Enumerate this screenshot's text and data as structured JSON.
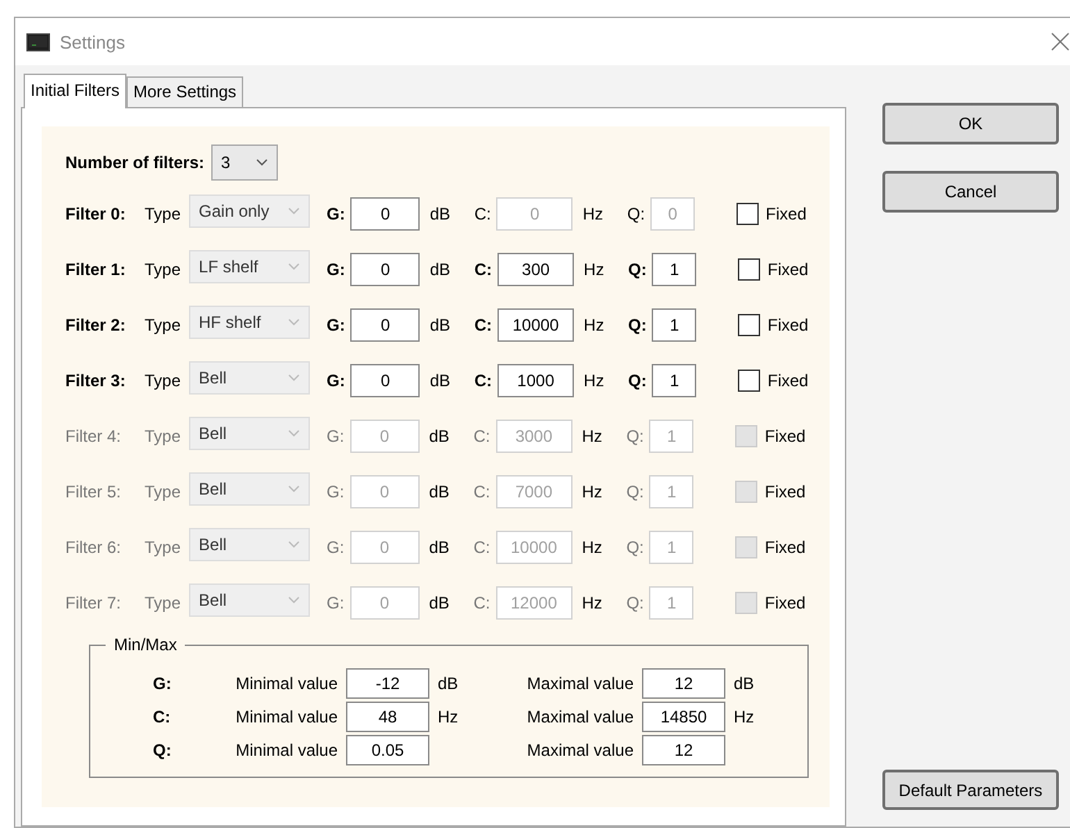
{
  "window": {
    "title": "Settings"
  },
  "tabs": [
    {
      "label": "Initial Filters",
      "selected": true
    },
    {
      "label": "More Settings",
      "selected": false
    }
  ],
  "number_of_filters": {
    "label": "Number of filters:",
    "value": "3"
  },
  "filters": [
    {
      "label": "Filter 0:",
      "enabled": true,
      "type_label": "Type",
      "type": "Gain only",
      "gain": {
        "label": "G:",
        "value": "0",
        "unit": "dB",
        "disabled": false
      },
      "center": {
        "label": "C:",
        "value": "0",
        "unit": "Hz",
        "disabled": true
      },
      "q": {
        "label": "Q:",
        "value": "0",
        "disabled": true
      },
      "fixed": {
        "label": "Fixed",
        "checked": false
      }
    },
    {
      "label": "Filter 1:",
      "enabled": true,
      "type_label": "Type",
      "type": "LF shelf",
      "gain": {
        "label": "G:",
        "value": "0",
        "unit": "dB",
        "disabled": false
      },
      "center": {
        "label": "C:",
        "value": "300",
        "unit": "Hz",
        "disabled": false
      },
      "q": {
        "label": "Q:",
        "value": "1",
        "disabled": false
      },
      "fixed": {
        "label": "Fixed",
        "checked": false
      }
    },
    {
      "label": "Filter 2:",
      "enabled": true,
      "type_label": "Type",
      "type": "HF shelf",
      "gain": {
        "label": "G:",
        "value": "0",
        "unit": "dB",
        "disabled": false
      },
      "center": {
        "label": "C:",
        "value": "10000",
        "unit": "Hz",
        "disabled": false
      },
      "q": {
        "label": "Q:",
        "value": "1",
        "disabled": false
      },
      "fixed": {
        "label": "Fixed",
        "checked": false
      }
    },
    {
      "label": "Filter 3:",
      "enabled": true,
      "type_label": "Type",
      "type": "Bell",
      "gain": {
        "label": "G:",
        "value": "0",
        "unit": "dB",
        "disabled": false
      },
      "center": {
        "label": "C:",
        "value": "1000",
        "unit": "Hz",
        "disabled": false
      },
      "q": {
        "label": "Q:",
        "value": "1",
        "disabled": false
      },
      "fixed": {
        "label": "Fixed",
        "checked": false
      }
    },
    {
      "label": "Filter 4:",
      "enabled": false,
      "type_label": "Type",
      "type": "Bell",
      "gain": {
        "label": "G:",
        "value": "0",
        "unit": "dB",
        "disabled": true
      },
      "center": {
        "label": "C:",
        "value": "3000",
        "unit": "Hz",
        "disabled": true
      },
      "q": {
        "label": "Q:",
        "value": "1",
        "disabled": true
      },
      "fixed": {
        "label": "Fixed",
        "checked": false
      }
    },
    {
      "label": "Filter 5:",
      "enabled": false,
      "type_label": "Type",
      "type": "Bell",
      "gain": {
        "label": "G:",
        "value": "0",
        "unit": "dB",
        "disabled": true
      },
      "center": {
        "label": "C:",
        "value": "7000",
        "unit": "Hz",
        "disabled": true
      },
      "q": {
        "label": "Q:",
        "value": "1",
        "disabled": true
      },
      "fixed": {
        "label": "Fixed",
        "checked": false
      }
    },
    {
      "label": "Filter 6:",
      "enabled": false,
      "type_label": "Type",
      "type": "Bell",
      "gain": {
        "label": "G:",
        "value": "0",
        "unit": "dB",
        "disabled": true
      },
      "center": {
        "label": "C:",
        "value": "10000",
        "unit": "Hz",
        "disabled": true
      },
      "q": {
        "label": "Q:",
        "value": "1",
        "disabled": true
      },
      "fixed": {
        "label": "Fixed",
        "checked": false
      }
    },
    {
      "label": "Filter 7:",
      "enabled": false,
      "type_label": "Type",
      "type": "Bell",
      "gain": {
        "label": "G:",
        "value": "0",
        "unit": "dB",
        "disabled": true
      },
      "center": {
        "label": "C:",
        "value": "12000",
        "unit": "Hz",
        "disabled": true
      },
      "q": {
        "label": "Q:",
        "value": "1",
        "disabled": true
      },
      "fixed": {
        "label": "Fixed",
        "checked": false
      }
    }
  ],
  "min_max": {
    "title": "Min/Max",
    "rows": [
      {
        "label": "G:",
        "min_label": "Minimal value",
        "min": "-12",
        "min_unit": "dB",
        "max_label": "Maximal value",
        "max": "12",
        "max_unit": "dB"
      },
      {
        "label": "C:",
        "min_label": "Minimal value",
        "min": "48",
        "min_unit": "Hz",
        "max_label": "Maximal value",
        "max": "14850",
        "max_unit": "Hz"
      },
      {
        "label": "Q:",
        "min_label": "Minimal value",
        "min": "0.05",
        "max_label": "Maximal value",
        "max": "12"
      }
    ]
  },
  "buttons": {
    "ok": "OK",
    "cancel": "Cancel",
    "default": "Default Parameters"
  }
}
